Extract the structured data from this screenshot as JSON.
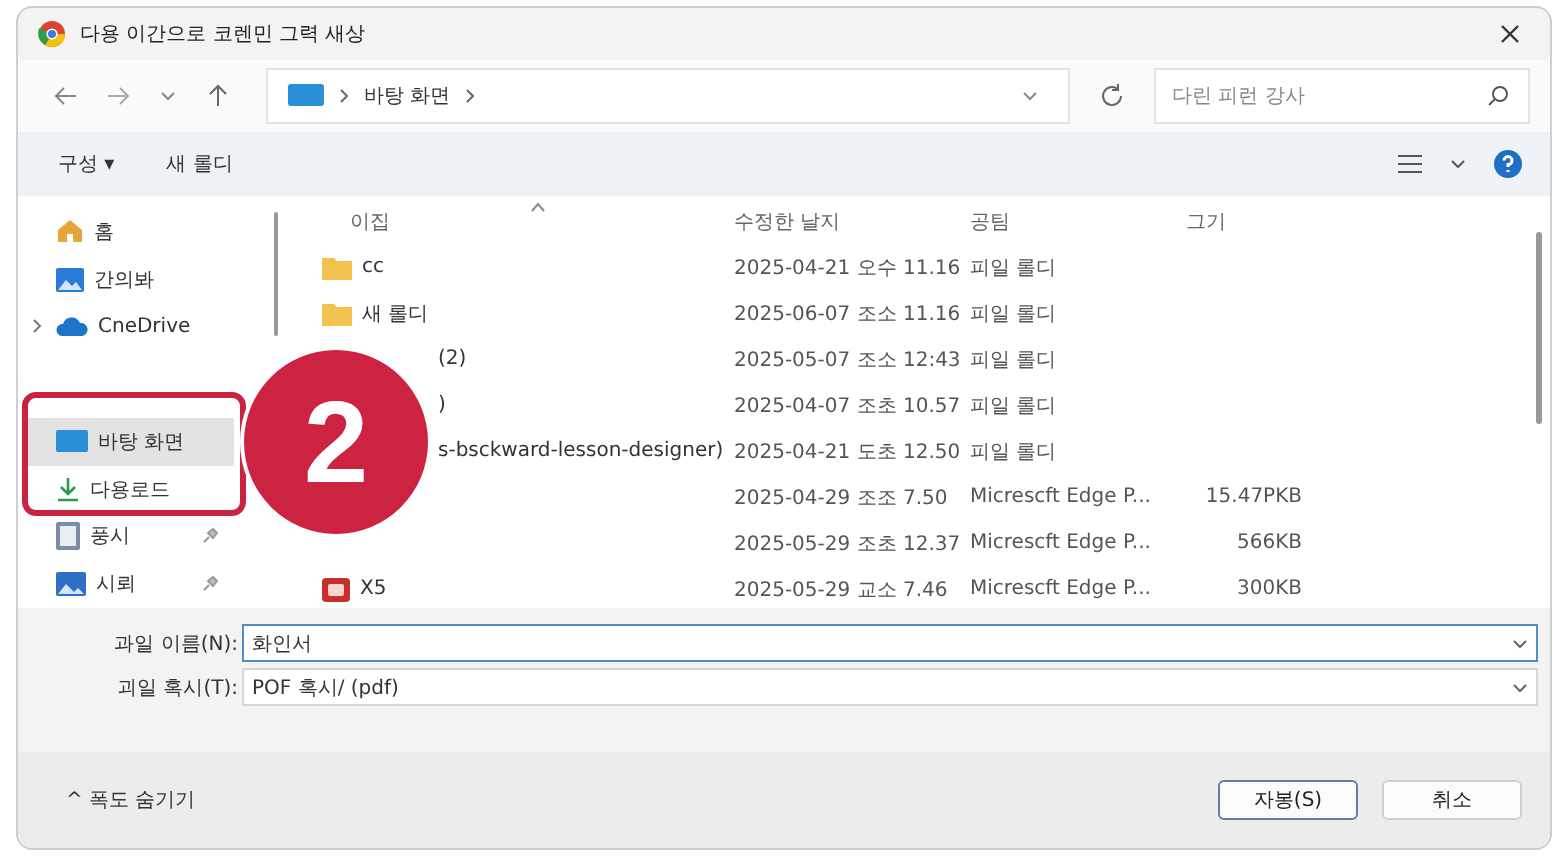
{
  "window": {
    "title": "다용 이간으로 코렌민 그력 새상"
  },
  "address": {
    "segments": [
      "바탕 화면"
    ]
  },
  "search": {
    "placeholder": "다린 피런 강사"
  },
  "toolbar": {
    "organize": "구성 ▾",
    "new_folder": "새 롤디"
  },
  "sidebar": {
    "items": [
      {
        "kind": "home",
        "label": "홈",
        "selected": false,
        "pinned": false,
        "expandable": false
      },
      {
        "kind": "gallery",
        "label": "간의봐",
        "selected": false,
        "pinned": false,
        "expandable": false
      },
      {
        "kind": "cloud",
        "label": "CneDrive",
        "selected": false,
        "pinned": false,
        "expandable": true
      },
      {
        "kind": "desktop",
        "label": "바탕 화면",
        "selected": true,
        "pinned": false,
        "expandable": false
      },
      {
        "kind": "download",
        "label": "다용로드",
        "selected": false,
        "pinned": false,
        "expandable": false
      },
      {
        "kind": "document",
        "label": "풍시",
        "selected": false,
        "pinned": true,
        "expandable": false
      },
      {
        "kind": "picture",
        "label": "시뢰",
        "selected": false,
        "pinned": true,
        "expandable": false
      }
    ]
  },
  "table": {
    "columns": [
      "이집",
      "수정한 날지",
      "공팀",
      "그기"
    ],
    "rows": [
      {
        "kind": "folder",
        "name": "cc",
        "date": "2025-04-21 오수 11.16",
        "type": "피일 롤디"
      },
      {
        "kind": "folder",
        "name": "새 롤디",
        "date": "2025-06-07 조소 11.16",
        "type": "피일 롤디"
      },
      {
        "name": "(2)",
        "date": "2025-05-07 조소 12:43",
        "type": "피일 롤디"
      },
      {
        "name": ")",
        "date": "2025-04-07 조초 10.57",
        "type": "피일 롤디"
      },
      {
        "name": "s-bsckward-lesson-designer)",
        "date": "2025-04-21 도초 12.50",
        "type": "피일 롤디"
      },
      {
        "date": "2025-04-29 조조 7.50",
        "type": "Micrescft Edge P...",
        "size": "15.47PKB"
      },
      {
        "date": "2025-05-29 조초 12.37",
        "type": "Micrescft Edge P...",
        "size": "566KB"
      },
      {
        "kind": "pdf",
        "name": "X5",
        "date": "2025-05-29 교소 7.46",
        "type": "Micrescft Edge P...",
        "size": "300KB"
      }
    ]
  },
  "form": {
    "filename_label": "과일 이름(N):",
    "filename": "화인서",
    "type_label": "괴일 혹시(T):",
    "type": "POF 혹시/ (pdf)"
  },
  "footer": {
    "hide_folders": "^ 폭도 숨기기",
    "save": "자봉(S)",
    "cancel": "취소"
  },
  "annotation": {
    "badge": "2",
    "highlight": true
  }
}
